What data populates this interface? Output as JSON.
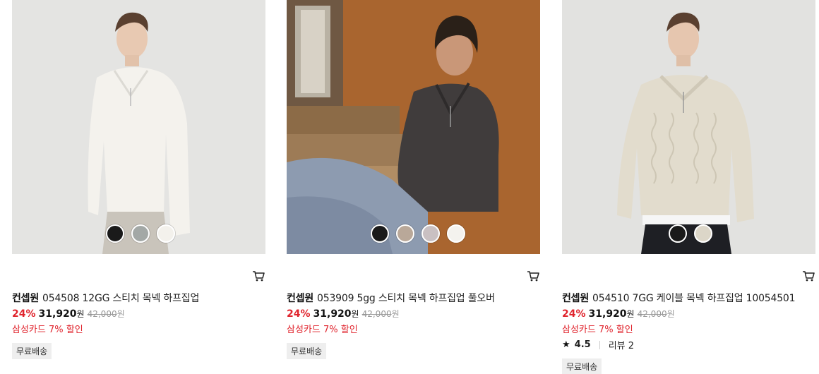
{
  "products": [
    {
      "brand": "컨셉원",
      "title": "054508 12GG 스티치 목넥 하프집업",
      "discount": "24%",
      "price": "31,920",
      "currency": "원",
      "original_price": "42,000",
      "card_promo": "삼성카드 7% 할인",
      "badge": "무료배송",
      "swatches": [
        "#1a1a1a",
        "#a3a8a6",
        "#f3f1ec"
      ],
      "icons": [
        "cart-icon"
      ]
    },
    {
      "brand": "컨셉원",
      "title": "053909 5gg 스티치 목넥 하프집업 풀오버",
      "discount": "24%",
      "price": "31,920",
      "currency": "원",
      "original_price": "42,000",
      "card_promo": "삼성카드 7% 할인",
      "badge": "무료배송",
      "swatches": [
        "#1a1a1a",
        "#b9a899",
        "#c9c0c2",
        "#f4f2ee"
      ],
      "icons": [
        "cart-icon"
      ]
    },
    {
      "brand": "컨셉원",
      "title": "054510 7GG 케이블 목넥 하프집업 10054501",
      "discount": "24%",
      "price": "31,920",
      "currency": "원",
      "original_price": "42,000",
      "card_promo": "삼성카드 7% 할인",
      "rating": "4.5",
      "review_label": "리뷰 2",
      "badge": "무료배송",
      "swatches": [
        "#1a1a1a",
        "#dcd6c8"
      ],
      "icons": [
        "star-icon",
        "cart-icon"
      ]
    }
  ],
  "colors": {
    "discount": "#e0242d",
    "badge_bg": "#eeeeee"
  }
}
